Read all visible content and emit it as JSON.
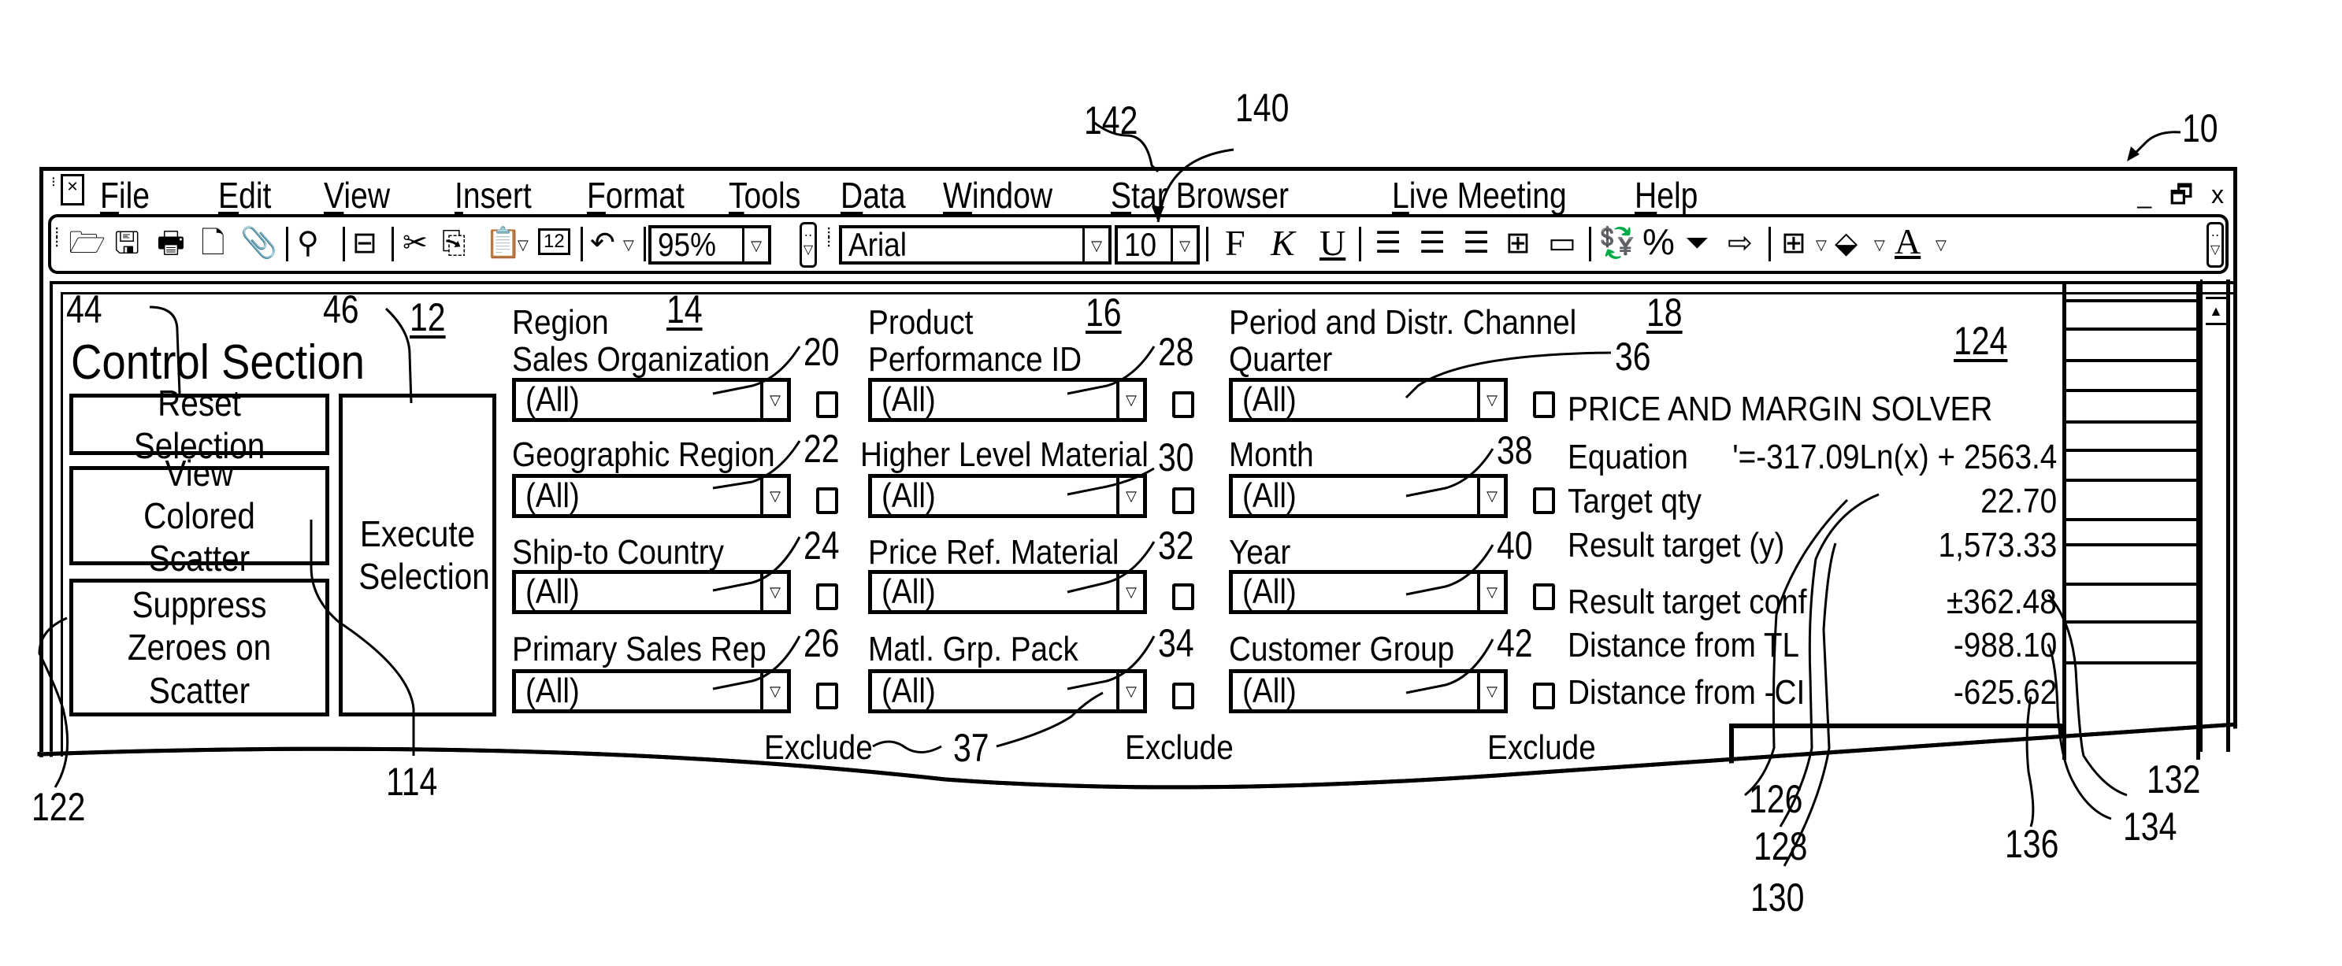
{
  "figure_refs": {
    "window": "10",
    "menu_live_meeting": "140",
    "menu_star_browser": "142",
    "control_section": "12",
    "region_group": "14",
    "product_group": "16",
    "period_group": "18",
    "solver": "124",
    "reset_button": "44",
    "execute_button": "46",
    "view_colored_button": "114",
    "suppress_button": "122",
    "exclude": "37",
    "equation": "126",
    "target_qty": "128",
    "result_target_y": "130",
    "result_conf": "132",
    "dist_tl": "134",
    "dist_ci": "136"
  },
  "menubar": {
    "items": [
      {
        "accel": "F",
        "rest": "ile"
      },
      {
        "accel": "E",
        "rest": "dit"
      },
      {
        "accel": "V",
        "rest": "iew"
      },
      {
        "accel": "I",
        "rest": "nsert"
      },
      {
        "accel": "F",
        "rest": "ormat"
      },
      {
        "accel": "T",
        "rest": "ools"
      },
      {
        "accel": "D",
        "rest": "ata"
      },
      {
        "accel": "W",
        "rest": "indow"
      },
      {
        "accel": "S",
        "rest": "tar Browser"
      },
      {
        "accel": "L",
        "rest": "ive Meeting"
      },
      {
        "accel": "H",
        "rest": "elp"
      }
    ],
    "window_controls": {
      "minimize": "_",
      "restore": "🗗",
      "close": "x"
    }
  },
  "toolbar": {
    "zoom": "95%",
    "font": "Arial",
    "font_size": "10",
    "bold_label": "F",
    "italic_label": "K",
    "underline_label": "U",
    "percent_label": "%",
    "font_color_label": "A"
  },
  "control_section": {
    "title": "Control Section",
    "reset_label": "Reset Selection",
    "view_colored_label": "View Colored Scatter",
    "suppress_label": "Suppress Zeroes on Scatter",
    "execute_label": "Execute Selection"
  },
  "filters": {
    "region": {
      "header": "Region",
      "fields": [
        {
          "label": "Sales Organization",
          "value": "(All)",
          "ref": "20"
        },
        {
          "label": "Geographic Region",
          "value": "(All)",
          "ref": "22"
        },
        {
          "label": "Ship-to Country",
          "value": "(All)",
          "ref": "24"
        },
        {
          "label": "Primary Sales Rep",
          "value": "(All)",
          "ref": "26"
        }
      ]
    },
    "product": {
      "header": "Product",
      "fields": [
        {
          "label": "Performance ID",
          "value": "(All)",
          "ref": "28"
        },
        {
          "label": "Higher Level Material",
          "value": "(All)",
          "ref": "30"
        },
        {
          "label": "Price Ref. Material",
          "value": "(All)",
          "ref": "32"
        },
        {
          "label": "Matl. Grp. Pack",
          "value": "(All)",
          "ref": "34"
        }
      ]
    },
    "period": {
      "header": "Period and Distr. Channel",
      "fields": [
        {
          "label": "Quarter",
          "value": "(All)",
          "ref": "36"
        },
        {
          "label": "Month",
          "value": "(All)",
          "ref": "38"
        },
        {
          "label": "Year",
          "value": "(All)",
          "ref": "40"
        },
        {
          "label": "Customer Group",
          "value": "(All)",
          "ref": "42"
        }
      ]
    },
    "exclude_label": "Exclude"
  },
  "solver": {
    "title": "PRICE AND MARGIN SOLVER",
    "rows": [
      {
        "label": "Equation",
        "value": "'=-317.09Ln(x) + 2563.4"
      },
      {
        "label": "Target qty",
        "value": "22.70"
      },
      {
        "label": "Result target (y)",
        "value": "1,573.33"
      },
      {
        "label": "Result target conf",
        "value": "±362.48"
      },
      {
        "label": "Distance from TL",
        "value": "-988.10"
      },
      {
        "label": "Distance from -CI",
        "value": "-625.62"
      }
    ]
  }
}
